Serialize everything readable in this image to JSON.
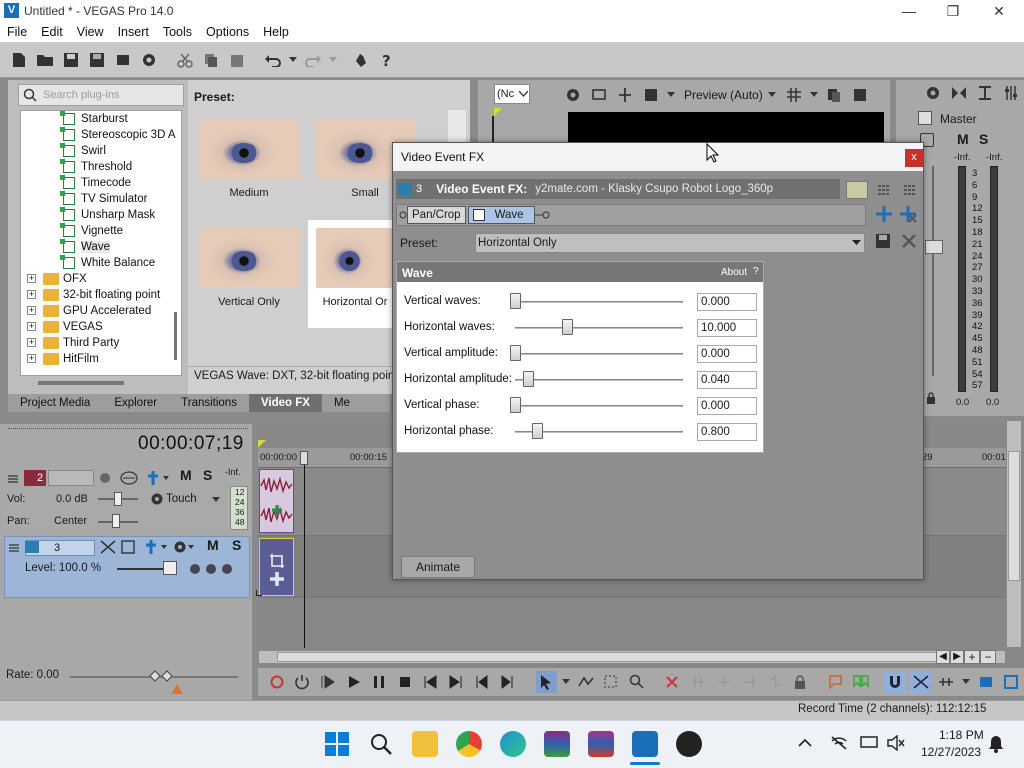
{
  "window": {
    "title": "Untitled * - VEGAS Pro 14.0",
    "logo_letter": "V",
    "minimize": "—",
    "restore": "❐",
    "close": "✕"
  },
  "menu": [
    "File",
    "Edit",
    "View",
    "Insert",
    "Tools",
    "Options",
    "Help"
  ],
  "plugins": {
    "search_placeholder": "Search plug-ins",
    "fx_items": [
      "Starburst",
      "Stereoscopic 3D A",
      "Swirl",
      "Threshold",
      "Timecode",
      "TV Simulator",
      "Unsharp Mask",
      "Vignette",
      "Wave",
      "White Balance"
    ],
    "selected_item": "Wave",
    "folders": [
      "OFX",
      "32-bit floating point",
      "GPU Accelerated",
      "VEGAS",
      "Third Party",
      "HitFilm"
    ],
    "expand_symbol": "+"
  },
  "presets": {
    "label": "Preset:",
    "items": [
      "Medium",
      "Small",
      "Vertical Only",
      "Horizontal Or"
    ],
    "status": "VEGAS Wave: DXT, 32-bit floating point"
  },
  "tabs": [
    "Project Media",
    "Explorer",
    "Transitions",
    "Video FX",
    "Me"
  ],
  "active_tab": "Video FX",
  "preview": {
    "combo_value": "(Nc",
    "quality": "Preview (Auto)"
  },
  "master": {
    "label": "Master",
    "mute": "M",
    "solo": "S",
    "inf_left": "-Inf.",
    "inf_right": "-Inf.",
    "scale": [
      "3",
      "6",
      "9",
      "12",
      "15",
      "18",
      "21",
      "24",
      "27",
      "30",
      "33",
      "36",
      "39",
      "42",
      "45",
      "48",
      "51",
      "54",
      "57"
    ],
    "readout_left": "0.0",
    "readout_right": "0.0"
  },
  "timeline": {
    "timecode": "00:00:07;19",
    "ruler_start": "00:00:00",
    "ruler_marks": [
      "00:00:15",
      "29",
      "00:01:"
    ],
    "rate": "Rate: 0.00"
  },
  "track2": {
    "number": "2",
    "mute": "M",
    "solo": "S",
    "vol_label": "Vol:",
    "vol_value": "0.0 dB",
    "touch": "Touch",
    "pan_label": "Pan:",
    "pan_value": "Center",
    "inf": "-Inf.",
    "meter_ticks": [
      "12",
      "24",
      "36",
      "48"
    ]
  },
  "track3": {
    "number": "3",
    "mute": "M",
    "solo": "S",
    "level": "Level: 100.0 %"
  },
  "status": {
    "record_time": "Record Time (2 channels): 112:12:15"
  },
  "dialog": {
    "title": "Video Event FX",
    "close": "x",
    "track_number": "3",
    "header_label": "Video Event FX:",
    "header_name": "y2mate.com - Klasky Csupo Robot Logo_360p",
    "chain": [
      "Pan/Crop",
      "Wave"
    ],
    "preset_label": "Preset:",
    "preset_value": "Horizontal Only",
    "panel_title": "Wave",
    "about": "About",
    "help": "?",
    "animate": "Animate",
    "params": [
      {
        "label": "Vertical waves:",
        "value": "0.000",
        "pos": 0.0
      },
      {
        "label": "Horizontal waves:",
        "value": "10.000",
        "pos": 0.31
      },
      {
        "label": "Vertical amplitude:",
        "value": "0.000",
        "pos": 0.0
      },
      {
        "label": "Horizontal amplitude:",
        "value": "0.040",
        "pos": 0.08
      },
      {
        "label": "Vertical phase:",
        "value": "0.000",
        "pos": 0.0
      },
      {
        "label": "Horizontal phase:",
        "value": "0.800",
        "pos": 0.13
      }
    ]
  },
  "taskbar": {
    "time": "1:18 PM",
    "date": "12/27/2023"
  },
  "colors": {
    "accent": "#1b6fb8",
    "close_red": "#c8312b",
    "selected_track": "#9db6d8"
  }
}
